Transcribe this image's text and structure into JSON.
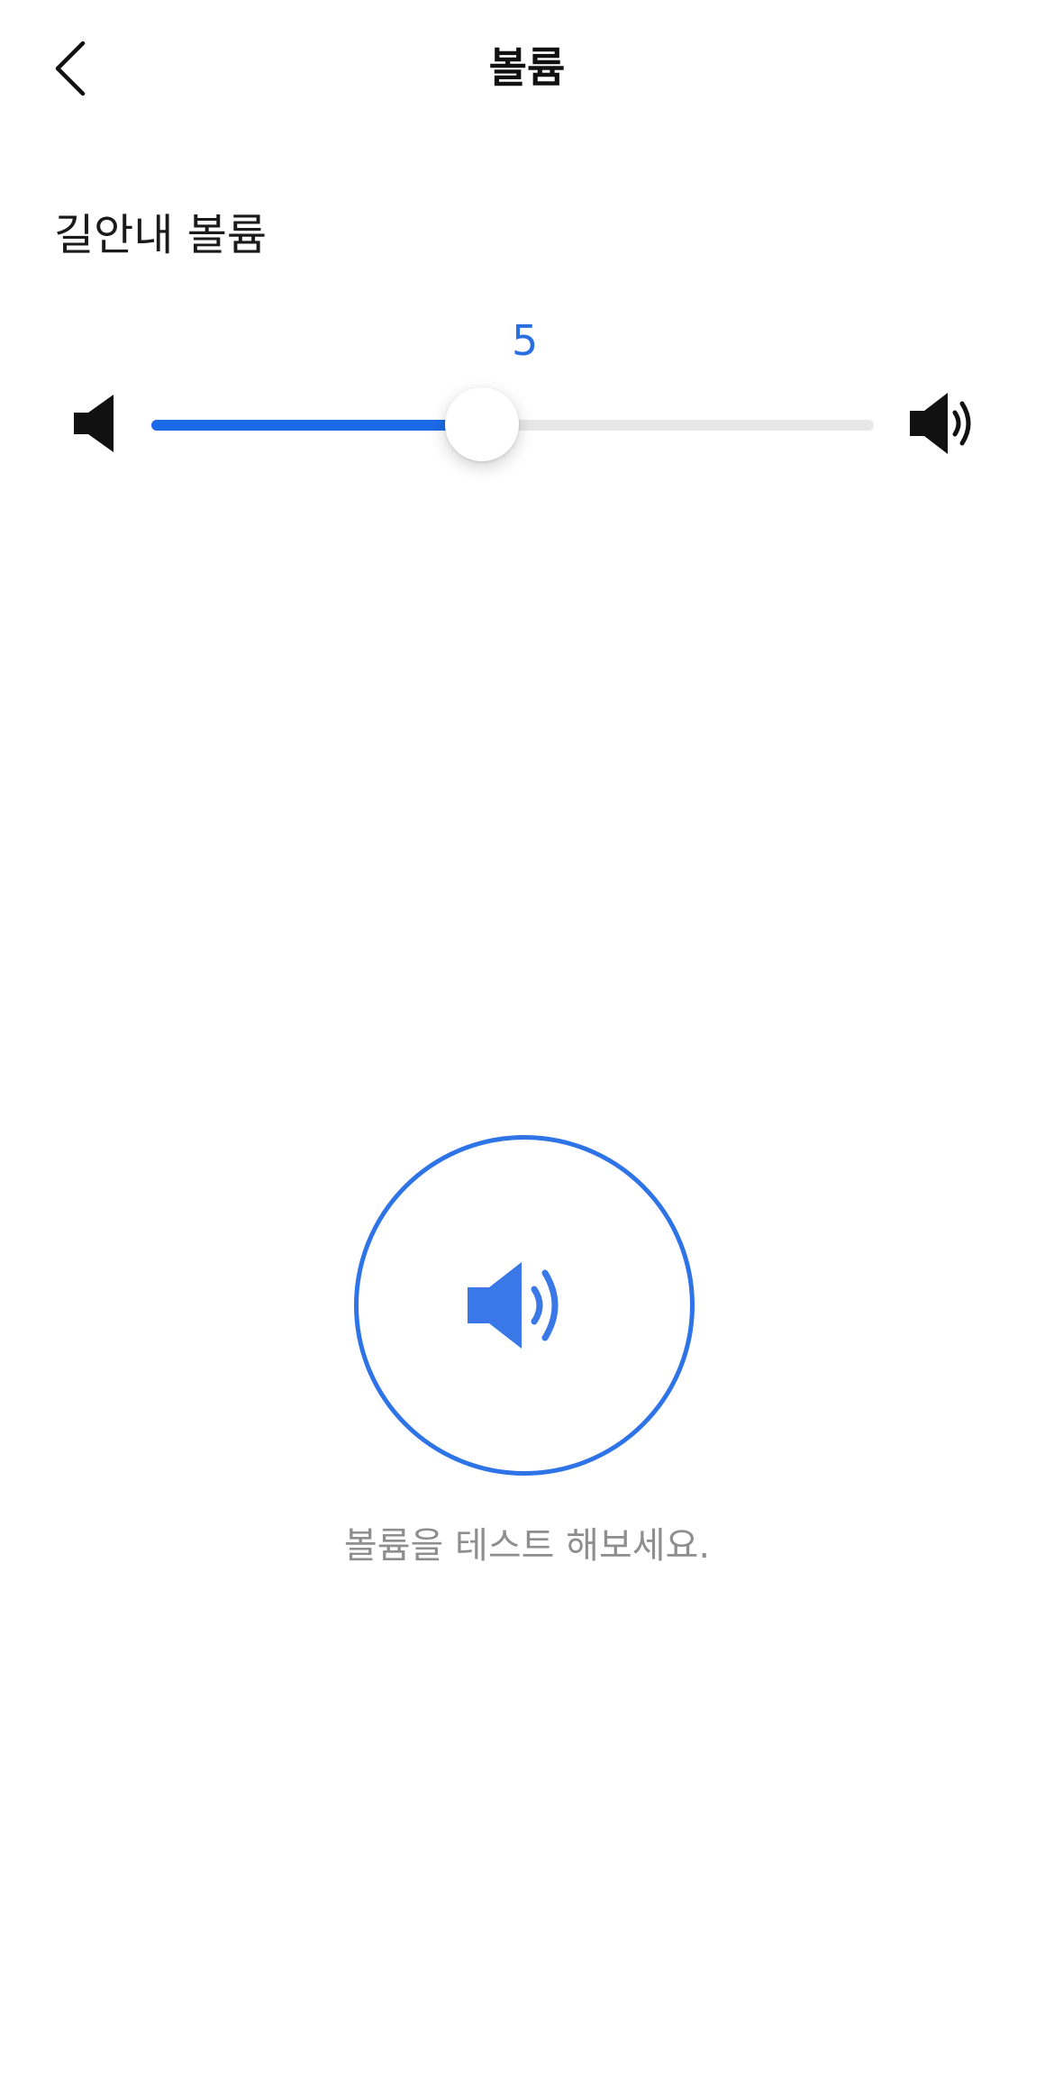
{
  "header": {
    "title": "볼륨",
    "back_icon": "chevron-left-icon"
  },
  "volume": {
    "label": "길안내 볼륨",
    "value": "5",
    "level_fraction": 0.5,
    "min_icon": "speaker-mute-icon",
    "max_icon": "speaker-loud-icon",
    "accent_color": "#1c6ae6",
    "track_color": "#e8e8e8"
  },
  "test": {
    "icon": "speaker-icon",
    "hint": "볼륨을 테스트 해보세요.",
    "accent_color": "#2f74e6",
    "hint_color": "#8e8e8e"
  }
}
